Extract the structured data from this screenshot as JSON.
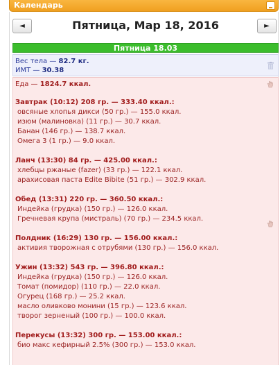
{
  "window": {
    "title": "Календарь"
  },
  "nav": {
    "prev": "◄",
    "next": "►",
    "date_title": "Пятница, Мар 18, 2016"
  },
  "day": {
    "header": "Пятница 18.03"
  },
  "body_stats": {
    "weight_label": "Вес тела — ",
    "weight_value": "82.7 кг.",
    "bmi_label": "ИМТ — ",
    "bmi_value": "30.38"
  },
  "food": {
    "total_label": "Еда — ",
    "total_value": "1824.7 ккал.",
    "meals": [
      {
        "head": "Завтрак (10:12) 208 гр. — 333.40 ккал.:",
        "items": [
          "овсяные хлопья дикси (50 гр.) — 155.0 ккал.",
          "изюм (малиновка) (11 гр.) — 30.7 ккал.",
          "Банан (146 гр.) — 138.7 ккал.",
          "Омега 3 (1 гр.) — 9.0 ккал."
        ]
      },
      {
        "head": "Ланч (13:30) 84 гр. — 425.00 ккал.:",
        "items": [
          "хлебцы ржаные (fazer) (33 гр.) — 122.1 ккал.",
          "арахисовая паста Edite Bibite (51 гр.) — 302.9 ккал."
        ]
      },
      {
        "head": "Обед (13:31) 220 гр. — 360.50 ккал.:",
        "items": [
          "Индейка (грудка) (150 гр.) — 126.0 ккал.",
          "Гречневая крупа (мистраль) (70 гр.) — 234.5 ккал."
        ]
      },
      {
        "head": "Полдник (16:29) 130 гр. — 156.00 ккал.:",
        "items": [
          "активия творожная с отрубями (130 гр.) — 156.0 ккал."
        ]
      },
      {
        "head": "Ужин (13:32) 543 гр. — 396.80 ккал.:",
        "items": [
          "Индейка (грудка) (150 гр.) — 126.0 ккал.",
          "Томат (помидор) (110 гр.) — 22.0 ккал.",
          "Огурец (168 гр.) — 25.2 ккал.",
          "масло оливково монини (15 гр.) — 123.6 ккал.",
          "творог зерненый (100 гр.) — 100.0 ккал."
        ]
      },
      {
        "head": "Перекусы (13:32) 300 гр. — 153.00 ккал.:",
        "items": [
          "био макс кефирный 2.5% (300 гр.) — 153.0 ккал."
        ]
      }
    ]
  },
  "colors": {
    "title_bar": "#f0a020",
    "day_header": "#3bbd2c",
    "stats_bg": "#eef0fb",
    "food_bg": "#fce9e9",
    "food_text": "#a02020"
  }
}
